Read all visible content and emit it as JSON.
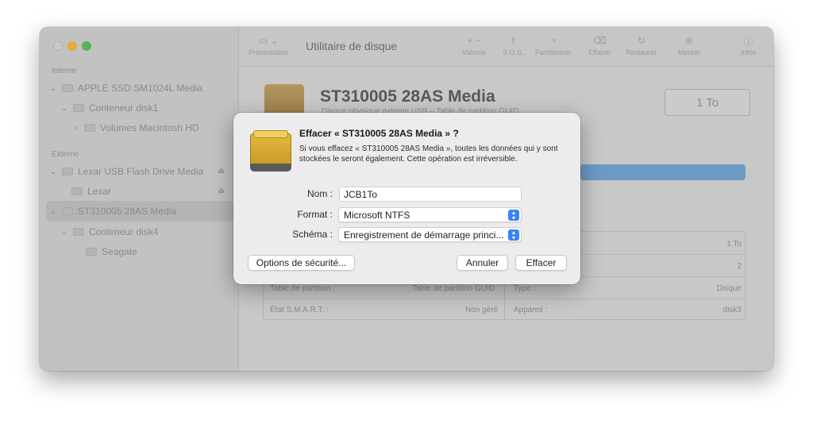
{
  "window": {
    "title": "Utilitaire de disque"
  },
  "sidebar": {
    "section_internal": "Interne",
    "section_external": "Externe",
    "items": [
      {
        "label": "APPLE SSD SM1024L Media"
      },
      {
        "label": "Conteneur disk1"
      },
      {
        "label": "Volumes Macintosh HD"
      },
      {
        "label": "Lexar USB Flash Drive Media"
      },
      {
        "label": "Lexar"
      },
      {
        "label": "ST310005 28AS Media"
      },
      {
        "label": "Conteneur disk4"
      },
      {
        "label": "Seagate"
      }
    ]
  },
  "toolbar": {
    "presentation": "Présentation",
    "volume": "Volume",
    "sos": "S.O.S.",
    "partition": "Partitionner",
    "erase": "Effacer",
    "restore": "Restaurer",
    "mount": "Monter",
    "info": "Infos",
    "icons": {
      "presentation": "sidebar-icon",
      "volume": "plus-minus-icon",
      "sos": "stethoscope-icon",
      "partition": "pie-icon",
      "erase": "erase-icon",
      "restore": "restore-icon",
      "mount": "mount-icon",
      "info": "info-icon"
    }
  },
  "disk": {
    "name": "ST310005 28AS Media",
    "subtitle": "Disque physique externe USB – Table de partition GUID",
    "capacity": "1 To"
  },
  "info": {
    "left": [
      {
        "label": "Table de partition :",
        "value": "Table de partition GUID"
      },
      {
        "label": "État S.M.A.R.T. :",
        "value": "Non géré"
      }
    ],
    "right": [
      {
        "label": "",
        "value": "1 To"
      },
      {
        "label": "",
        "value": "2"
      },
      {
        "label": "Type :",
        "value": "Disque"
      },
      {
        "label": "Appareil :",
        "value": "disk3"
      }
    ]
  },
  "dialog": {
    "title": "Effacer « ST310005 28AS Media » ?",
    "message": "Si vous effacez « ST310005 28AS Media », toutes les données qui y sont stockées le seront également. Cette opération est irréversible.",
    "name_label": "Nom :",
    "name_value": "JCB1To",
    "format_label": "Format :",
    "format_value": "Microsoft NTFS",
    "scheme_label": "Schéma :",
    "scheme_value": "Enregistrement de démarrage princi...",
    "security_button": "Options de sécurité...",
    "cancel_button": "Annuler",
    "erase_button": "Effacer"
  },
  "colors": {
    "accent": "#3b82f6",
    "usage_bar": "#6d9ac4",
    "drive_icon": "#d9ad33"
  }
}
